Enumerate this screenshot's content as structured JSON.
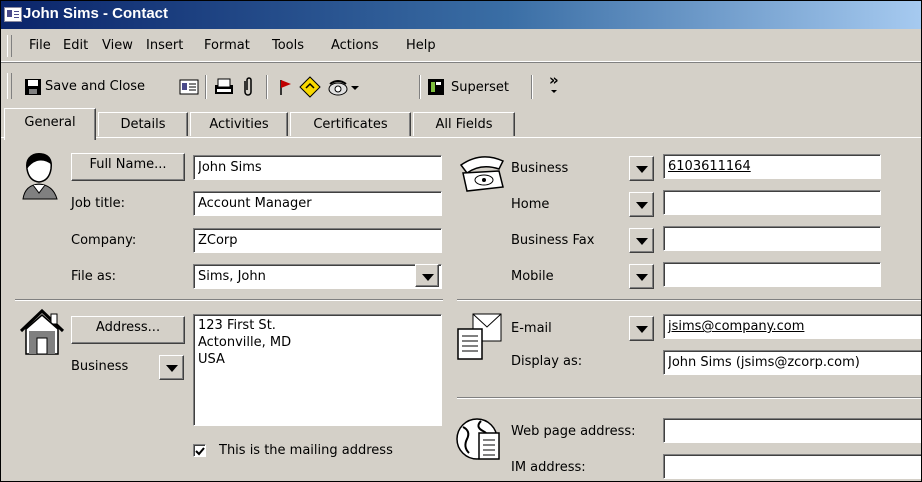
{
  "window": {
    "title": "John Sims - Contact"
  },
  "menu": {
    "items": [
      "File",
      "Edit",
      "View",
      "Insert",
      "Format",
      "Tools",
      "Actions",
      "Help"
    ]
  },
  "toolbar": {
    "save_close_label": "Save and Close",
    "superset_label": "Superset",
    "overflow": "»"
  },
  "tabs": [
    "General",
    "Details",
    "Activities",
    "Certificates",
    "All Fields"
  ],
  "name_section": {
    "full_name_button": "Full Name...",
    "full_name_value": "John Sims",
    "job_title_label": "Job title:",
    "job_title_value": "Account Manager",
    "company_label": "Company:",
    "company_value": "ZCorp",
    "file_as_label": "File as:",
    "file_as_value": "Sims, John"
  },
  "phones": [
    {
      "label": "Business",
      "value": "6103611164"
    },
    {
      "label": "Home",
      "value": ""
    },
    {
      "label": "Business Fax",
      "value": ""
    },
    {
      "label": "Mobile",
      "value": ""
    }
  ],
  "address": {
    "button": "Address...",
    "type": "Business",
    "value": "123 First St.\nActonville, MD\nUSA",
    "mailing_checkbox_label": "This is the mailing address",
    "mailing_checked": true
  },
  "email": {
    "label": "E-mail",
    "value": "jsims@company.com",
    "display_as_label": "Display as:",
    "display_as_value": "John Sims (jsims@zcorp.com)"
  },
  "web": {
    "web_label": "Web page address:",
    "web_value": "",
    "im_label": "IM address:",
    "im_value": ""
  }
}
